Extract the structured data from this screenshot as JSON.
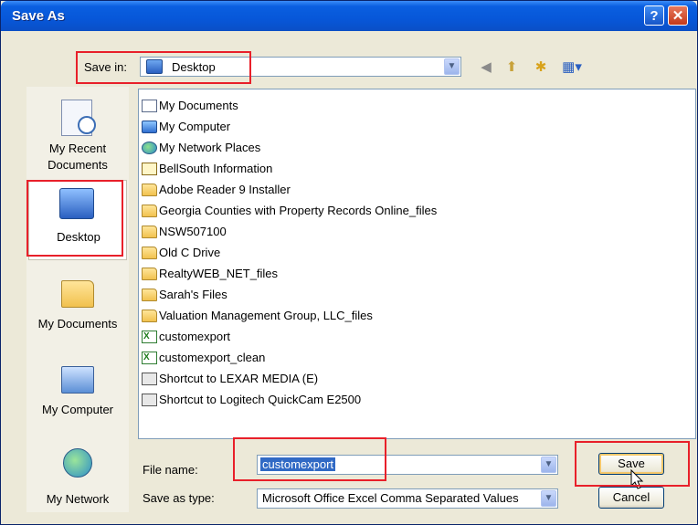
{
  "window": {
    "title": "Save As"
  },
  "titlebar": {
    "help": "?",
    "close": "✕"
  },
  "save_in": {
    "label": "Save in:",
    "value": "Desktop"
  },
  "toolbar": {
    "back_icon": "back-icon",
    "up_icon": "up-folder-icon",
    "new_folder_icon": "new-folder-icon",
    "views_icon": "views-menu-icon"
  },
  "places": [
    {
      "label": "My Recent Documents",
      "line1": "My Recent",
      "line2": "Documents",
      "icon": "recent-documents-icon"
    },
    {
      "label": "Desktop",
      "line1": "Desktop",
      "icon": "desktop-icon"
    },
    {
      "label": "My Documents",
      "line1": "My Documents",
      "icon": "my-documents-icon"
    },
    {
      "label": "My Computer",
      "line1": "My Computer",
      "icon": "my-computer-icon"
    },
    {
      "label": "My Network",
      "line1": "My Network",
      "icon": "my-network-icon"
    }
  ],
  "files": [
    {
      "name": "My Documents",
      "type": "doc"
    },
    {
      "name": "My Computer",
      "type": "computer"
    },
    {
      "name": "My Network Places",
      "type": "network"
    },
    {
      "name": "BellSouth Information",
      "type": "info"
    },
    {
      "name": "Adobe Reader 9 Installer",
      "type": "folder"
    },
    {
      "name": "Georgia Counties with Property Records Online_files",
      "type": "folder"
    },
    {
      "name": "NSW507100",
      "type": "folder"
    },
    {
      "name": "Old C Drive",
      "type": "folder"
    },
    {
      "name": "RealtyWEB_NET_files",
      "type": "folder"
    },
    {
      "name": "Sarah's Files",
      "type": "folder"
    },
    {
      "name": "Valuation Management Group, LLC_files",
      "type": "folder"
    },
    {
      "name": "customexport",
      "type": "xls"
    },
    {
      "name": "customexport_clean",
      "type": "xls"
    },
    {
      "name": "Shortcut to LEXAR MEDIA (E)",
      "type": "shortcut"
    },
    {
      "name": "Shortcut to Logitech QuickCam E2500",
      "type": "shortcut"
    }
  ],
  "file_name": {
    "label": "File name:",
    "value": "customexport"
  },
  "save_as_type": {
    "label": "Save as type:",
    "value": "Microsoft Office Excel Comma Separated Values"
  },
  "buttons": {
    "save": "Save",
    "cancel": "Cancel"
  },
  "colors": {
    "titlebar": "#0757d9",
    "annotation": "#e8202a",
    "selection": "#316ac5"
  }
}
